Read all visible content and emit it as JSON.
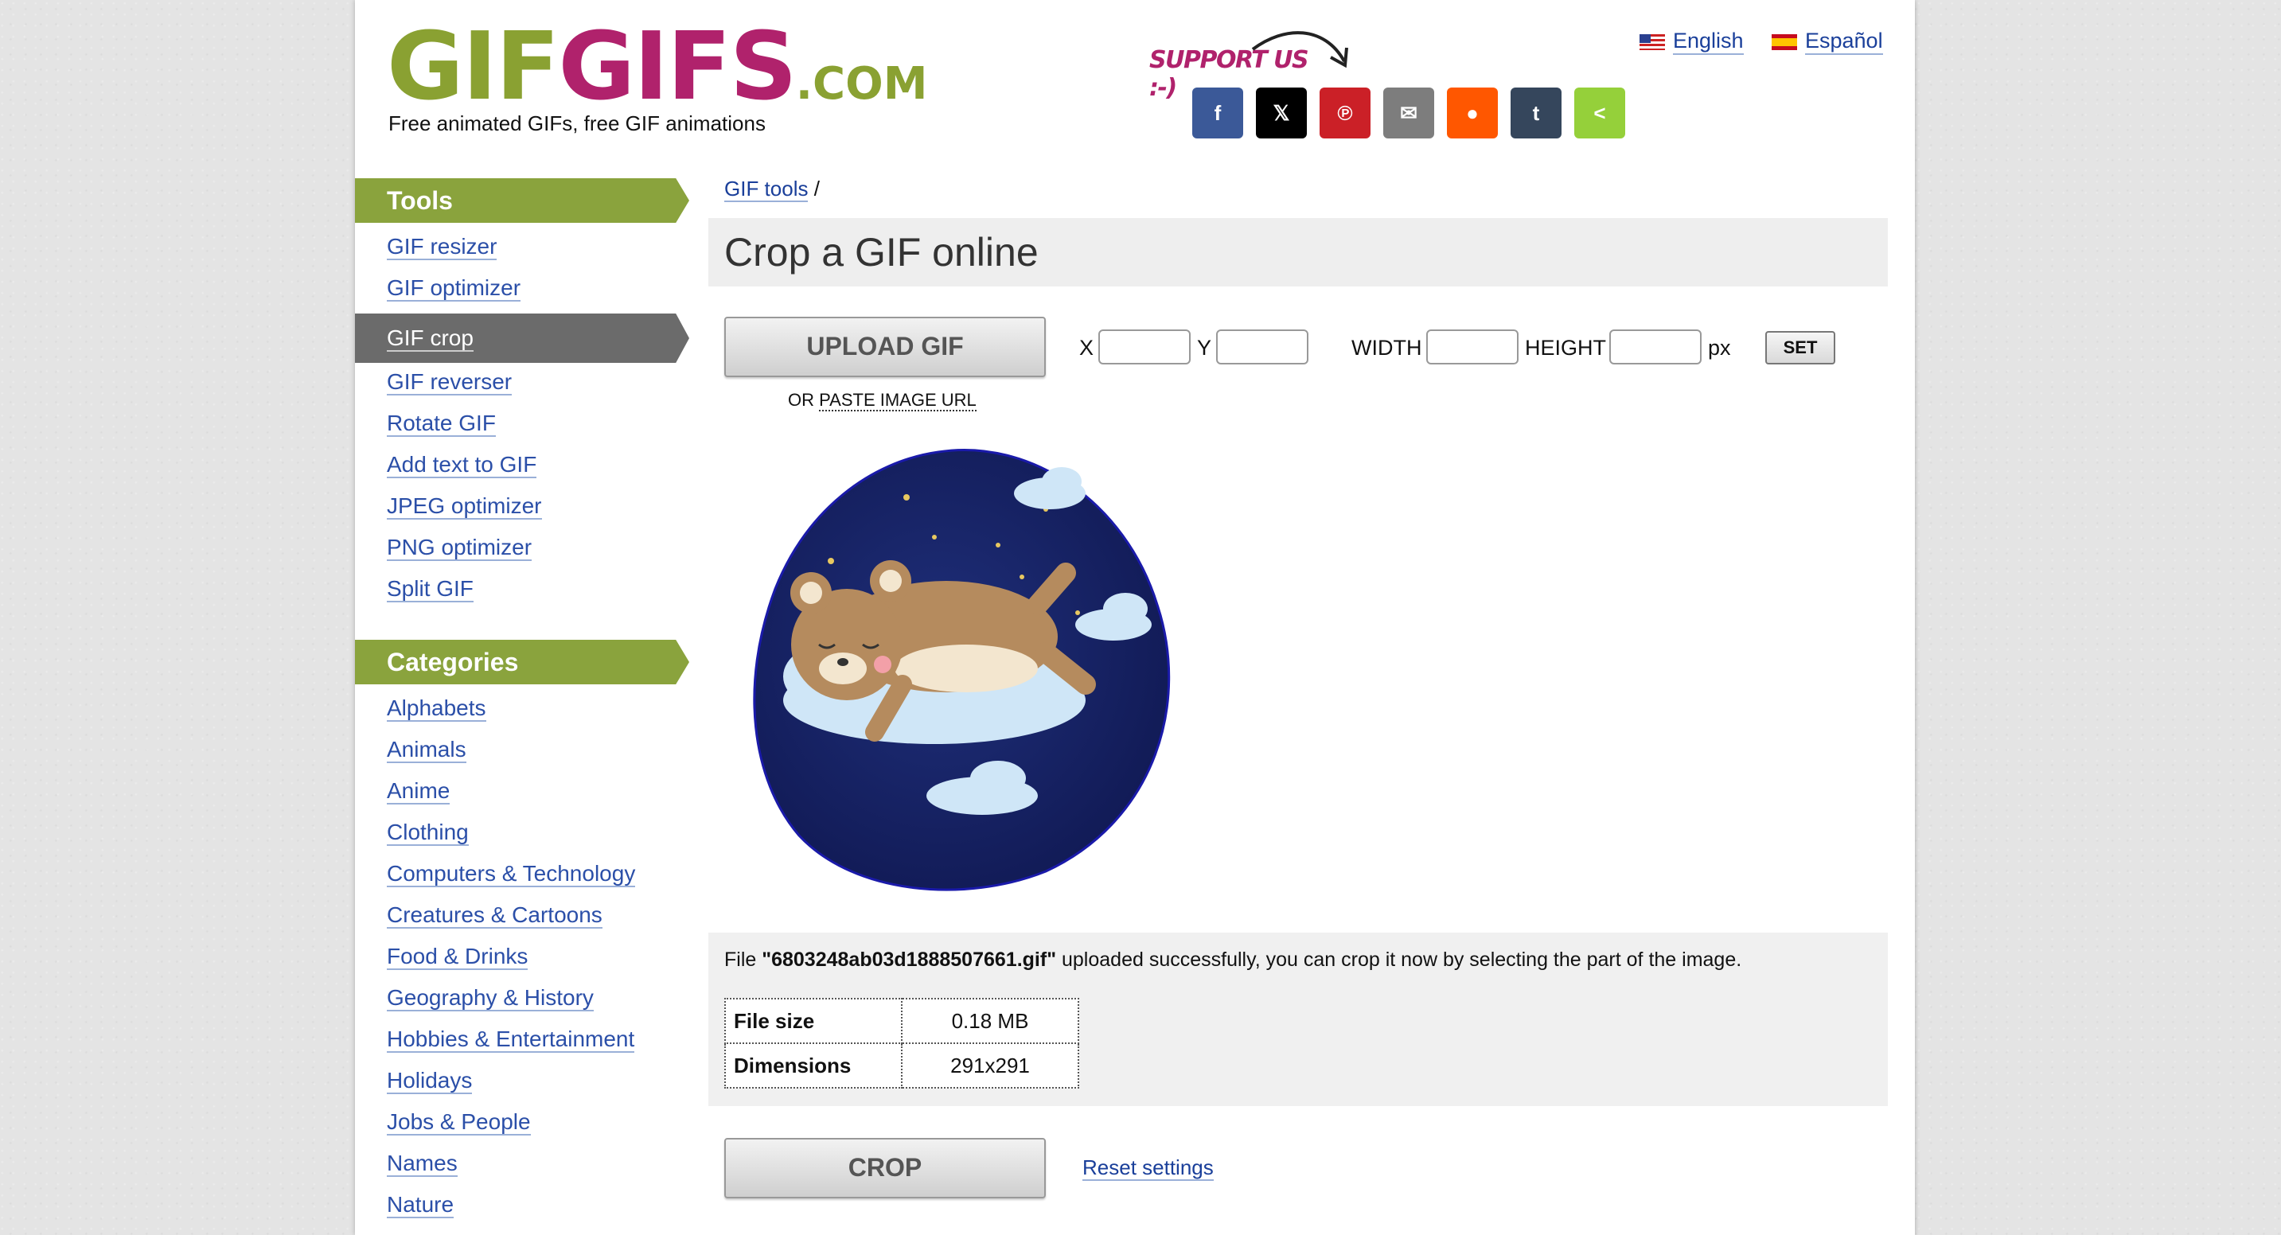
{
  "header": {
    "logo_part1": "GIF",
    "logo_part2": "GIFS",
    "logo_part3": ".COM",
    "tagline": "Free animated GIFs, free GIF animations",
    "support_text": "SUPPORT US :-)",
    "share_buttons": [
      {
        "icon": "facebook-icon",
        "glyph": "f",
        "color": "#3b5998"
      },
      {
        "icon": "x-icon",
        "glyph": "𝕏",
        "color": "#000000"
      },
      {
        "icon": "pinterest-icon",
        "glyph": "℗",
        "color": "#cb2027"
      },
      {
        "icon": "email-icon",
        "glyph": "✉",
        "color": "#7d7d7d"
      },
      {
        "icon": "reddit-icon",
        "glyph": "●",
        "color": "#ff5700"
      },
      {
        "icon": "tumblr-icon",
        "glyph": "t",
        "color": "#35465c"
      },
      {
        "icon": "share-icon",
        "glyph": "<",
        "color": "#95d03a"
      }
    ],
    "languages": [
      {
        "label": "English",
        "flag": "us-flag-icon"
      },
      {
        "label": "Español",
        "flag": "es-flag-icon"
      }
    ]
  },
  "sidebar": {
    "tools_heading": "Tools",
    "tools": [
      "GIF resizer",
      "GIF optimizer",
      "GIF crop",
      "GIF reverser",
      "Rotate GIF",
      "Add text to GIF",
      "JPEG optimizer",
      "PNG optimizer",
      "Split GIF"
    ],
    "active_tool": "GIF crop",
    "categories_heading": "Categories",
    "categories": [
      "Alphabets",
      "Animals",
      "Anime",
      "Clothing",
      "Computers & Technology",
      "Creatures & Cartoons",
      "Food & Drinks",
      "Geography & History",
      "Hobbies & Entertainment",
      "Holidays",
      "Jobs & People",
      "Names",
      "Nature"
    ]
  },
  "main": {
    "breadcrumb_link": "GIF tools",
    "breadcrumb_sep": "/",
    "title": "Crop a GIF online",
    "upload_button": "UPLOAD GIF",
    "or_text": "OR",
    "paste_url_text": "PASTE IMAGE URL",
    "x_label": "X",
    "y_label": "Y",
    "width_label": "WIDTH",
    "height_label": "HEIGHT",
    "px_label": "px",
    "x_value": "",
    "y_value": "",
    "width_value": "",
    "height_value": "",
    "set_button": "SET",
    "message_prefix": "File ",
    "message_filename": "\"6803248ab03d1888507661.gif\"",
    "message_suffix": " uploaded successfully, you can crop it now by selecting the part of the image.",
    "file_info": [
      {
        "label": "File size",
        "value": "0.18 MB"
      },
      {
        "label": "Dimensions",
        "value": "291x291"
      }
    ],
    "crop_button": "CROP",
    "reset_link": "Reset settings"
  }
}
